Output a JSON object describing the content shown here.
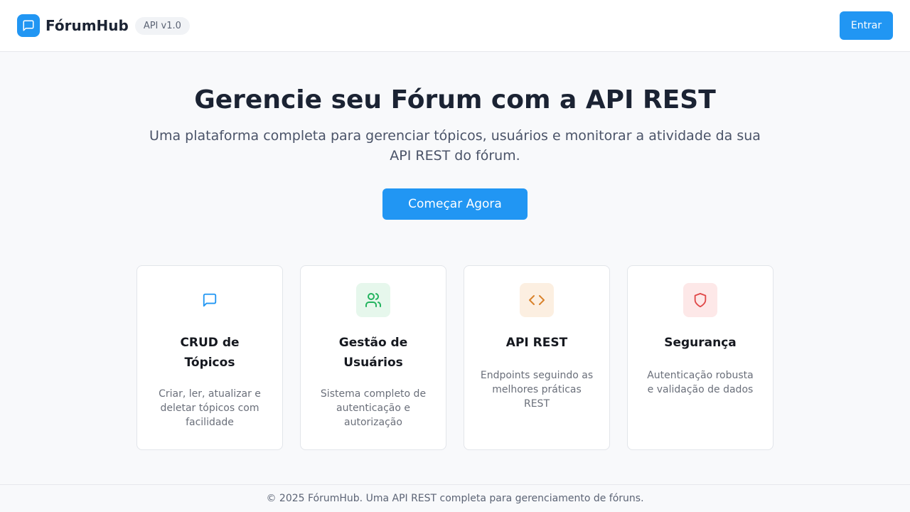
{
  "header": {
    "brand_name": "FórumHub",
    "api_badge": "API v1.0",
    "login_label": "Entrar",
    "logo_icon": "chat-bubble-icon",
    "accent_color": "#2196f3"
  },
  "hero": {
    "title": "Gerencie seu Fórum com a API REST",
    "subtitle": "Uma plataforma completa para gerenciar tópicos, usuários e monitorar a atividade da sua API REST do fórum.",
    "cta_label": "Começar Agora"
  },
  "features": [
    {
      "icon": "chat-bubble-icon",
      "icon_color": "#2196f3",
      "icon_bg": "#ffffff",
      "title": "CRUD de Tópicos",
      "description": "Criar, ler, atualizar e deletar tópicos com facilidade"
    },
    {
      "icon": "users-icon",
      "icon_color": "#22b35e",
      "icon_bg": "#e6f7ec",
      "title": "Gestão de Usuários",
      "description": "Sistema completo de autenticação e autorização"
    },
    {
      "icon": "code-icon",
      "icon_color": "#d9822b",
      "icon_bg": "#fcefe1",
      "title": "API REST",
      "description": "Endpoints seguindo as melhores práticas REST"
    },
    {
      "icon": "shield-icon",
      "icon_color": "#e04848",
      "icon_bg": "#fde8e8",
      "title": "Segurança",
      "description": "Autenticação robusta e validação de dados"
    }
  ],
  "footer": {
    "text": "© 2025 FórumHub. Uma API REST completa para gerenciamento de fóruns."
  }
}
